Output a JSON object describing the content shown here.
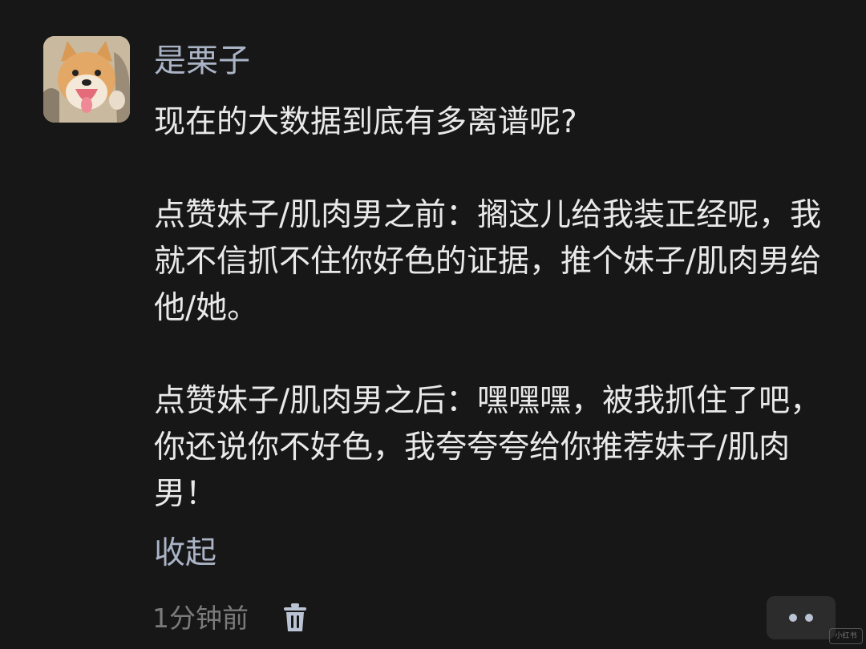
{
  "comment": {
    "username": "是栗子",
    "avatar_icon": "shiba-dog-avatar",
    "paragraphs": [
      "现在的大数据到底有多离谱呢?",
      "点赞妹子/肌肉男之前：搁这儿给我装正经呢，我就不信抓不住你好色的证据，推个妹子/肌肉男给他/她。",
      "点赞妹子/肌肉男之后：嘿嘿嘿，被我抓住了吧，你还说你不好色，我夸夸夸给你推荐妹子/肌肉男！"
    ],
    "collapse_label": "收起",
    "timestamp": "1分钟前",
    "delete_icon": "trash-icon",
    "more_icon": "more-dots-icon",
    "watermark": "小红书"
  },
  "colors": {
    "background": "#171717",
    "text": "#e9e9e9",
    "link": "#aab4c6",
    "muted": "#7b7b7b"
  }
}
